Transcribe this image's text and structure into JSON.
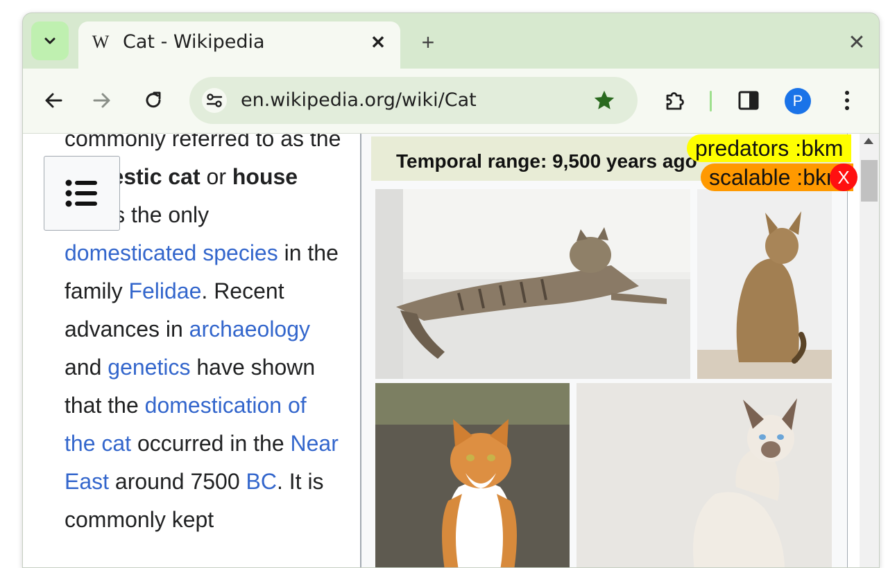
{
  "tab": {
    "favicon": "W",
    "title": "Cat - Wikipedia",
    "close_label": "✕"
  },
  "tabstrip": {
    "new_tab_label": "+",
    "close_window_label": "✕"
  },
  "omnibox": {
    "url": "en.wikipedia.org/wiki/Cat"
  },
  "profile": {
    "initial": "P"
  },
  "article": {
    "segments": [
      {
        "text": "commonly referred to as ",
        "link": false
      },
      {
        "text": "the ",
        "link": false
      },
      {
        "text": "domestic cat",
        "link": false,
        "bold": true
      },
      {
        "text": " or ",
        "link": false
      },
      {
        "text": "house cat",
        "link": false,
        "bold": true
      },
      {
        "text": ", is the only ",
        "link": false
      },
      {
        "text": "domesticated species",
        "link": true
      },
      {
        "text": " in the family ",
        "link": false
      },
      {
        "text": "Felidae",
        "link": true
      },
      {
        "text": ". Recent advances in ",
        "link": false
      },
      {
        "text": "archaeology",
        "link": true
      },
      {
        "text": " and ",
        "link": false
      },
      {
        "text": "genetics",
        "link": true
      },
      {
        "text": " have shown that the ",
        "link": false
      },
      {
        "text": "domestication of the cat",
        "link": true
      },
      {
        "text": " occurred in the ",
        "link": false
      },
      {
        "text": "Near East",
        "link": true
      },
      {
        "text": " around 7500 ",
        "link": false
      },
      {
        "text": "BC",
        "link": true
      },
      {
        "text": ". It is commonly kept",
        "link": false
      }
    ]
  },
  "infobox": {
    "temporal": "Temporal range: 9,500 years ago"
  },
  "overlay_tags": [
    {
      "text": "predators :bkm",
      "color": "#ffff00"
    },
    {
      "text": "scalable :bkm",
      "color": "#ff9900"
    }
  ],
  "overlay_close": "X",
  "colors": {
    "link": "#3366cc",
    "frame": "#d7e9cf",
    "toolbar": "#f6f9f2",
    "omnibox": "#e2eddb",
    "accent": "#1a73e8"
  }
}
